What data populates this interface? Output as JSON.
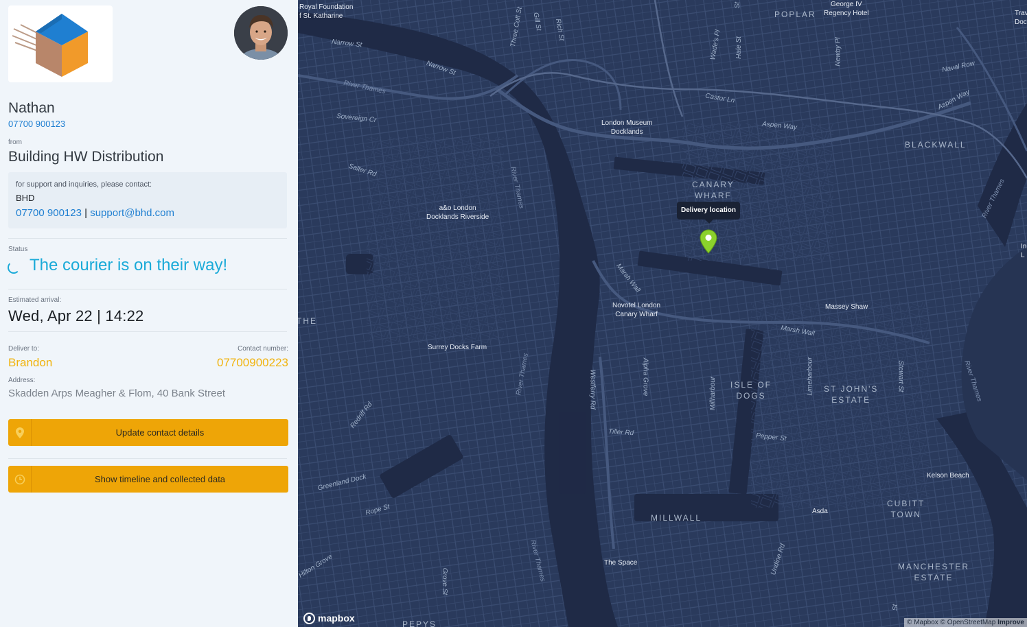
{
  "courier": {
    "name": "Nathan",
    "phone": "07700 900123"
  },
  "sender": {
    "from_label": "from",
    "company": "Building HW Distribution",
    "support_note": "for support and inquiries, please contact:",
    "support_company": "BHD",
    "support_phone": "07700 900123",
    "support_separator": "|",
    "support_email": "support@bhd.com"
  },
  "status": {
    "label": "Status",
    "text": "The courier is on their way!"
  },
  "eta": {
    "label": "Estimated arrival:",
    "value": "Wed, Apr 22 | 14:22"
  },
  "delivery": {
    "deliver_label": "Deliver to:",
    "recipient": "Brandon",
    "contact_label": "Contact number:",
    "contact_value": "07700900223",
    "address_label": "Address:",
    "address": "Skadden Arps Meagher & Flom, 40 Bank Street"
  },
  "buttons": {
    "update_contact": "Update contact details",
    "show_timeline": "Show timeline and collected data"
  },
  "icons": {
    "update_contact": "pin-icon",
    "show_timeline": "clock-icon",
    "status": "spinner-icon"
  },
  "colors": {
    "accent_blue": "#1aaad8",
    "link_blue": "#1f7fd1",
    "accent_yellow": "#f1b30c",
    "button": "#eea507",
    "map_land": "#2a3a5c",
    "map_water": "#1f2a46",
    "pin": "#8bd12c"
  },
  "map": {
    "tooltip": "Delivery location",
    "brand": "mapbox",
    "attribution_1": "© Mapbox",
    "attribution_2": "© OpenStreetMap",
    "attribution_improve": "Improve",
    "places": {
      "royal_foundation_1": "Royal Foundation",
      "royal_foundation_2": "f St. Katharine",
      "george_1": "George IV",
      "george_2": "Regency Hotel",
      "trav_1": "Trav",
      "trav_2": "Doc",
      "museum_1": "London Museum",
      "museum_2": "Docklands",
      "ao_1": "a&o London",
      "ao_2": "Docklands Riverside",
      "novotel_1": "Novotel London",
      "novotel_2": "Canary Wharf",
      "surrey": "Surrey Docks Farm",
      "massey": "Massey Shaw",
      "kelson": "Kelson Beach",
      "asda": "Asda",
      "space": "The Space",
      "right_edge_1": "In",
      "right_edge_2": "L"
    },
    "areas": {
      "poplar": "POPLAR",
      "blackwall": "BLACKWALL",
      "canary_1": "CANARY",
      "canary_2": "WHARF",
      "the": "THE",
      "isle_1": "ISLE OF",
      "isle_2": "DOGS",
      "stjohn_1": "ST JOHN'S",
      "stjohn_2": "ESTATE",
      "millwall": "MILLWALL",
      "cubitt_1": "CUBITT",
      "cubitt_2": "TOWN",
      "manchester_1": "MANCHESTER",
      "manchester_2": "ESTATE",
      "pepys": "PEPYS"
    },
    "streets": {
      "narrow_st_1": "Narrow St",
      "narrow_st_2": "Narrow St",
      "sovereign": "Sovereign Cr",
      "salter": "Salter Rd",
      "castor": "Castor Ln",
      "aspen_1": "Aspen Way",
      "aspen_2": "Aspen Way",
      "naval": "Naval Row",
      "marsh_1": "Marsh Wall",
      "marsh_2": "Marsh Wall",
      "westferry": "Westferry Rd",
      "alpha": "Alpha Grove",
      "millharbour": "Millharbour",
      "limeharbour": "Limeharbour",
      "stewart": "Stewart St",
      "tiller": "Tiller Rd",
      "pepper": "Pepper St",
      "redriff": "Redriff Rd",
      "greenland": "Greenland Dock",
      "rope": "Rope St",
      "hilton": "Hilton Grove",
      "grove": "Grove St",
      "undine": "Undine Rd",
      "three_colt": "Three Colt St",
      "gill": "Gill St",
      "rich": "Rich St",
      "wade": "Wade's Pl",
      "hale": "Hale St",
      "newby": "Newby Pl",
      "bottom_st": "St",
      "top_st": "St"
    },
    "rivers": {
      "r1": "River Thames",
      "r2": "River Thames",
      "r3": "River Thames",
      "r4": "River Thames",
      "r5": "River Thames",
      "r6": "River Thames"
    }
  }
}
